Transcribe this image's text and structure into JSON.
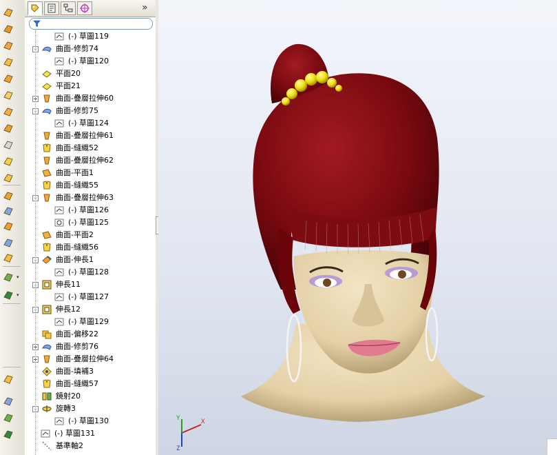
{
  "feature_tree": {
    "filter_icon": "funnel-icon",
    "more_label": "»",
    "tabs": [
      {
        "name": "feature-manager-tab",
        "icon": "feature-tree-icon"
      },
      {
        "name": "property-manager-tab",
        "icon": "property-icon"
      },
      {
        "name": "configuration-manager-tab",
        "icon": "configuration-icon"
      },
      {
        "name": "dimxpert-tab",
        "icon": "crosshair-icon"
      }
    ],
    "items": [
      {
        "label": "(-) 草圖119",
        "icon": "sketch-icon",
        "indent": 1,
        "expander": ""
      },
      {
        "label": "曲面-修剪74",
        "icon": "surface-trim-icon",
        "indent": 0,
        "expander": "−"
      },
      {
        "label": "(-) 草圖120",
        "icon": "sketch-icon",
        "indent": 1,
        "expander": ""
      },
      {
        "label": "平面20",
        "icon": "plane-icon",
        "indent": 0,
        "expander": ""
      },
      {
        "label": "平面21",
        "icon": "plane-icon",
        "indent": 0,
        "expander": ""
      },
      {
        "label": "曲面-疊層拉伸60",
        "icon": "surface-loft-icon",
        "indent": 0,
        "expander": "+"
      },
      {
        "label": "曲面-修剪75",
        "icon": "surface-trim-icon",
        "indent": 0,
        "expander": "−"
      },
      {
        "label": "(-) 草圖124",
        "icon": "sketch-icon",
        "indent": 1,
        "expander": ""
      },
      {
        "label": "曲面-疊層拉伸61",
        "icon": "surface-loft-icon",
        "indent": 0,
        "expander": ""
      },
      {
        "label": "曲面-縫織52",
        "icon": "surface-knit-icon",
        "indent": 0,
        "expander": ""
      },
      {
        "label": "曲面-疊層拉伸62",
        "icon": "surface-loft-icon",
        "indent": 0,
        "expander": ""
      },
      {
        "label": "曲面-平面1",
        "icon": "planar-surface-icon",
        "indent": 0,
        "expander": ""
      },
      {
        "label": "曲面-縫織55",
        "icon": "surface-knit-icon",
        "indent": 0,
        "expander": ""
      },
      {
        "label": "曲面-疊層拉伸63",
        "icon": "surface-loft-icon",
        "indent": 0,
        "expander": "−"
      },
      {
        "label": "(-) 草圖126",
        "icon": "sketch-icon",
        "indent": 1,
        "expander": ""
      },
      {
        "label": "(-) 草圖125",
        "icon": "sketch-3d-icon",
        "indent": 1,
        "expander": ""
      },
      {
        "label": "曲面-平面2",
        "icon": "planar-surface-icon",
        "indent": 0,
        "expander": ""
      },
      {
        "label": "曲面-縫織56",
        "icon": "surface-knit-icon",
        "indent": 0,
        "expander": ""
      },
      {
        "label": "曲面-伸長1",
        "icon": "surface-extend-icon",
        "indent": 0,
        "expander": "−"
      },
      {
        "label": "(-) 草圖128",
        "icon": "sketch-icon",
        "indent": 1,
        "expander": ""
      },
      {
        "label": "伸長11",
        "icon": "extrude-icon",
        "indent": 0,
        "expander": "−"
      },
      {
        "label": "(-) 草圖127",
        "icon": "sketch-icon",
        "indent": 1,
        "expander": ""
      },
      {
        "label": "伸長12",
        "icon": "extrude-icon",
        "indent": 0,
        "expander": "−"
      },
      {
        "label": "(-) 草圖129",
        "icon": "sketch-icon",
        "indent": 1,
        "expander": ""
      },
      {
        "label": "曲面-偏移22",
        "icon": "surface-offset-icon",
        "indent": 0,
        "expander": ""
      },
      {
        "label": "曲面-修剪76",
        "icon": "surface-trim-icon",
        "indent": 0,
        "expander": "+"
      },
      {
        "label": "曲面-疊層拉伸64",
        "icon": "surface-loft-icon",
        "indent": 0,
        "expander": "+"
      },
      {
        "label": "曲面-填補3",
        "icon": "surface-fill-icon",
        "indent": 0,
        "expander": ""
      },
      {
        "label": "曲面-縫織57",
        "icon": "surface-knit-icon",
        "indent": 0,
        "expander": ""
      },
      {
        "label": "鏡射20",
        "icon": "mirror-icon",
        "indent": 0,
        "expander": ""
      },
      {
        "label": "旋轉3",
        "icon": "revolve-icon",
        "indent": 0,
        "expander": "−"
      },
      {
        "label": "(-) 草圖130",
        "icon": "sketch-icon",
        "indent": 1,
        "expander": ""
      },
      {
        "label": "(-) 草圖131",
        "icon": "sketch-icon",
        "indent": -1,
        "expander": ""
      },
      {
        "label": "基準軸2",
        "icon": "axis-icon",
        "indent": 0,
        "expander": ""
      }
    ]
  },
  "toolbar": {
    "tools": [
      "extruded-surface-icon",
      "revolved-surface-icon",
      "swept-surface-icon",
      "lofted-surface-icon",
      "planar-surface-icon",
      "offset-surface-icon",
      "radiate-surface-icon",
      "ruled-surface-icon",
      "delete-face-icon",
      "fill-surface-icon",
      "knit-surface-icon",
      "trim-surface-icon",
      "untrim-surface-icon",
      "extend-surface-icon",
      "surface-flatten-icon",
      "thicken-icon",
      "mid-surface-icon",
      "curves-icon",
      "replace-face-icon",
      "cut-with-surface-icon",
      "split-line-icon",
      "helix-icon",
      "projected-curve-icon"
    ],
    "dropdown_arrow": "▾"
  },
  "viewport": {
    "triad_labels": {
      "x": "X",
      "y": "Y",
      "z": "Z"
    },
    "colors": {
      "hair": "#7a0a10",
      "skin": "#e8d6b0",
      "beads": "#f2e415",
      "lips": "#e27a90",
      "background": "#e6eaf3"
    }
  }
}
